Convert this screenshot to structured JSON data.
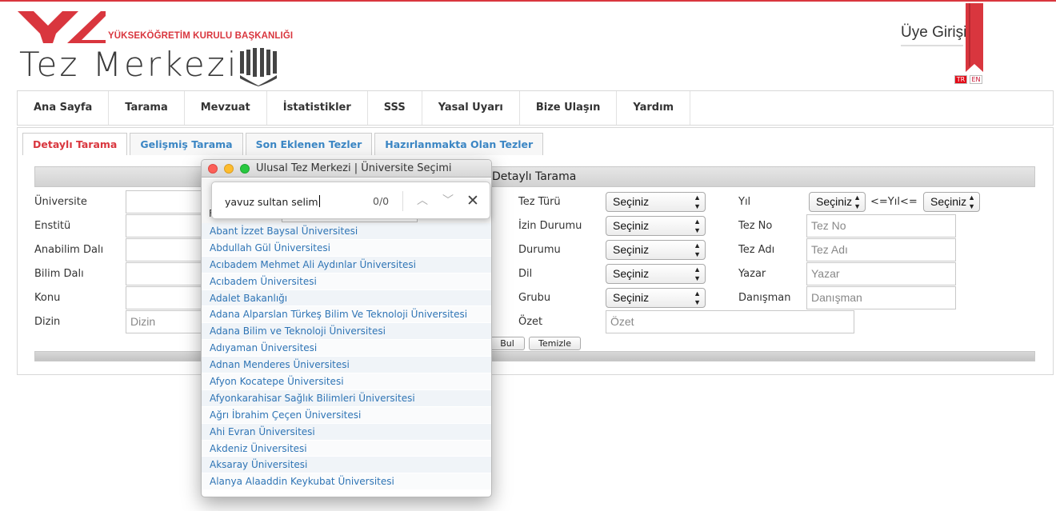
{
  "header": {
    "org_name": "YÜKSEKÖĞRETİM KURULU BAŞKANLIĞI",
    "site_title": "Tez Merkezi",
    "member_login": "Üye Girişi",
    "lang_tr": "TR",
    "lang_en": "EN"
  },
  "colors": {
    "brand_red": "#d9363e",
    "link_blue": "#2e74b5"
  },
  "nav": [
    "Ana Sayfa",
    "Tarama",
    "Mevzuat",
    "İstatistikler",
    "SSS",
    "Yasal Uyarı",
    "Bize Ulaşın",
    "Yardım"
  ],
  "tabs": [
    "Detaylı Tarama",
    "Gelişmiş Tarama",
    "Son Eklenen Tezler",
    "Hazırlanmakta Olan Tezler"
  ],
  "form": {
    "title": "Detaylı Tarama",
    "left_labels": [
      "Üniversite",
      "Enstitü",
      "Anabilim Dalı",
      "Bilim Dalı",
      "Konu",
      "Dizin"
    ],
    "dizin_placeholder": "Dizin",
    "mid_labels": [
      "Tez Türü",
      "İzin Durumu",
      "Durumu",
      "Dil",
      "Grubu",
      "Özet"
    ],
    "select_value": "Seçiniz",
    "ozet_placeholder": "Özet",
    "right_labels": [
      "Yıl",
      "Tez No",
      "Tez Adı",
      "Yazar",
      "Danışman"
    ],
    "year_sep": "<=Yıl<=",
    "tez_no_placeholder": "Tez No",
    "tez_adi_placeholder": "Tez Adı",
    "yazar_placeholder": "Yazar",
    "danisman_placeholder": "Danışman",
    "btn_search": "Bul",
    "btn_clear": "Temizle"
  },
  "popup": {
    "window_title": "Ulusal Tez Merkezi | Üniversite Seçimi",
    "label": "F",
    "universities": [
      "Abant İzzet Baysal Üniversitesi",
      "Abdullah Gül Üniversitesi",
      "Acıbadem Mehmet Ali Aydınlar Üniversitesi",
      "Acıbadem Üniversitesi",
      "Adalet Bakanlığı",
      "Adana Alparslan Türkeş Bilim Ve Teknoloji Üniversitesi",
      "Adana Bilim ve Teknoloji Üniversitesi",
      "Adıyaman Üniversitesi",
      "Adnan Menderes Üniversitesi",
      "Afyon Kocatepe Üniversitesi",
      "Afyonkarahisar Sağlık Bilimleri Üniversitesi",
      "Ağrı İbrahim Çeçen Üniversitesi",
      "Ahi Evran Üniversitesi",
      "Akdeniz Üniversitesi",
      "Aksaray Üniversitesi",
      "Alanya Alaaddin Keykubat Üniversitesi"
    ]
  },
  "findbar": {
    "query": "yavuz sultan selim",
    "count": "0/0",
    "prev_icon": "chevron-up-icon",
    "next_icon": "chevron-down-icon",
    "close_icon": "close-icon"
  }
}
